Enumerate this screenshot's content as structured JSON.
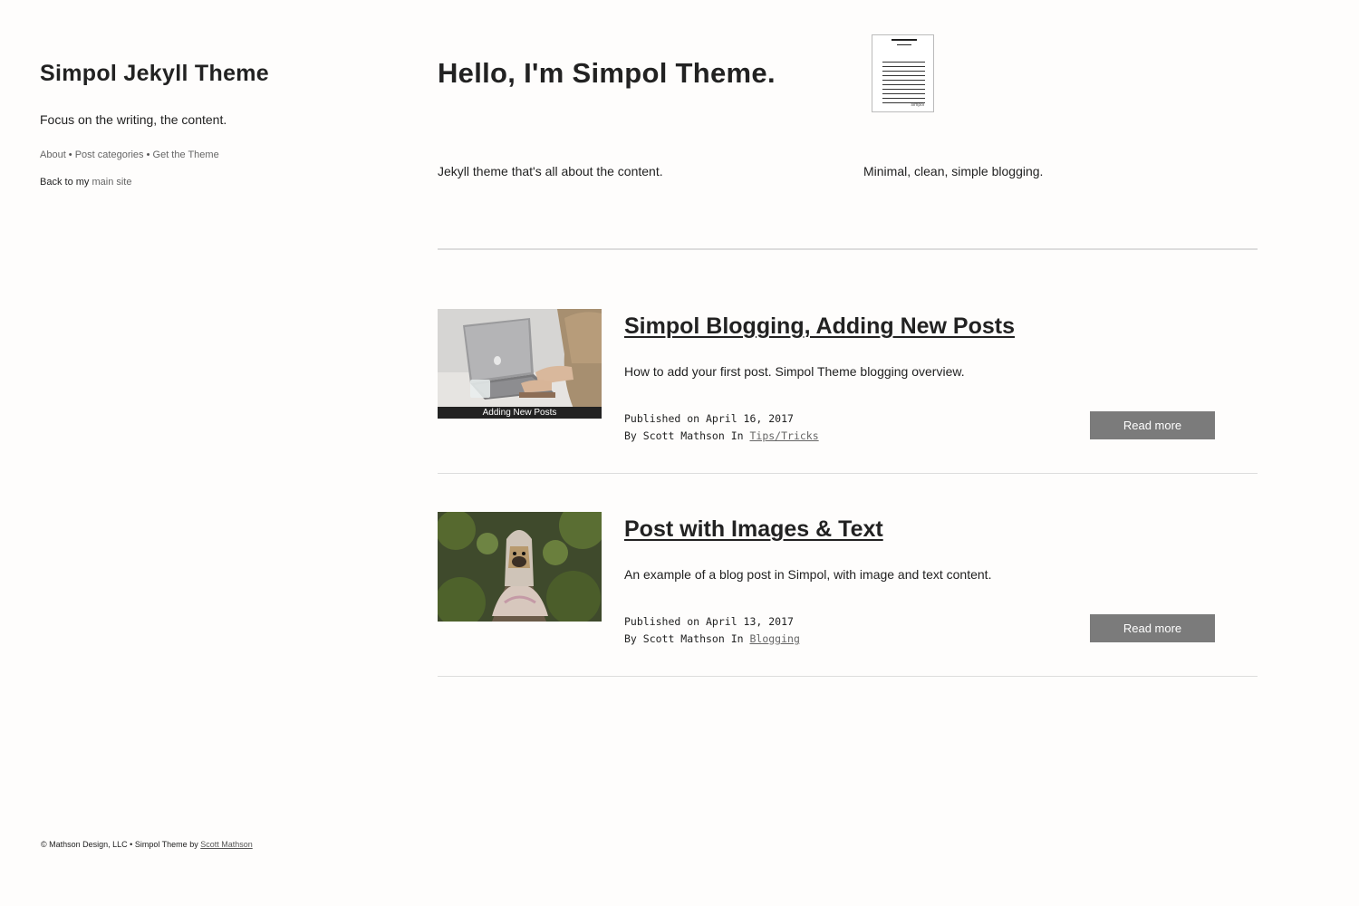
{
  "sidebar": {
    "title": "Simpol Jekyll Theme",
    "tagline": "Focus on the writing, the content.",
    "nav": [
      {
        "label": "About"
      },
      {
        "label": "Post categories"
      },
      {
        "label": "Get the Theme"
      }
    ],
    "nav_separator": " • ",
    "back_prefix": "Back to my ",
    "back_link": "main site"
  },
  "hero": {
    "title": "Hello, I'm Simpol Theme.",
    "logo_text": "simpol",
    "col1": "Jekyll theme that's all about the content.",
    "col2": "Minimal, clean, simple blogging."
  },
  "posts": [
    {
      "title": "Simpol Blogging, Adding New Posts",
      "description": "How to add your first post. Simpol Theme blogging overview.",
      "published": "Published on April 16, 2017",
      "byline": "By Scott Mathson In ",
      "category": "Tips/Tricks",
      "read_more": "Read more",
      "image_caption": "Adding New Posts"
    },
    {
      "title": "Post with Images & Text",
      "description": "An example of a blog post in Simpol, with image and text content.",
      "published": "Published on April 13, 2017",
      "byline": "By Scott Mathson In ",
      "category": "Blogging",
      "read_more": "Read more"
    }
  ],
  "footer": {
    "text": "© Mathson Design, LLC • Simpol Theme by ",
    "link": "Scott Mathson"
  },
  "colors": {
    "background": "#fefdfc",
    "text": "#222222",
    "button": "#7b7b7b",
    "rule": "#dddddd"
  }
}
